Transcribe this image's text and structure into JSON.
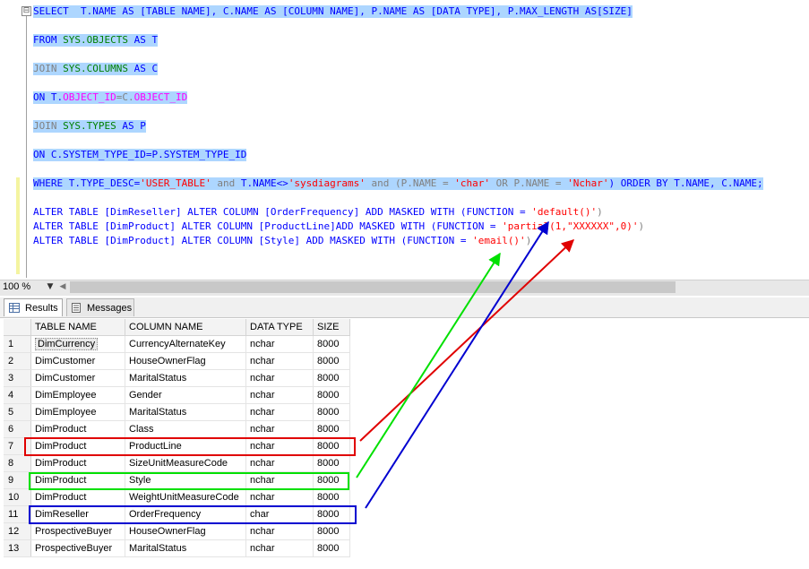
{
  "editor": {
    "lines": [
      [
        "SELECT  T.NAME AS [TABLE NAME], C.NAME AS [COLUMN NAME], P.NAME AS [DATA TYPE], P.MAX_LENGTH AS[SIZE]"
      ],
      [
        "FROM ",
        "SYS.OBJECTS",
        " AS T"
      ],
      [
        "JOIN ",
        "SYS.COLUMNS",
        " AS C"
      ],
      [
        "ON T.",
        "OBJECT_ID",
        "=C.",
        "OBJECT_ID"
      ],
      [
        "JOIN ",
        "SYS.TYPES",
        " AS P"
      ],
      [
        "ON C.SYSTEM_TYPE_ID=P.SYSTEM_TYPE_ID"
      ],
      [
        "WHERE T.TYPE_DESC=",
        "'USER_TABLE'",
        " and ",
        "T.NAME<>",
        "'sysdiagrams'",
        " and (P.NAME = ",
        "'char'",
        " OR P.NAME = ",
        "'Nchar'",
        ") ORDER BY T.NAME, C.NAME;"
      ],
      [
        "ALTER TABLE [DimReseller] ALTER COLUMN [OrderFrequency] ADD MASKED WITH (FUNCTION = ",
        "'default()'",
        ")"
      ],
      [
        "ALTER TABLE [DimProduct] ALTER COLUMN [ProductLine]ADD MASKED WITH (FUNCTION = ",
        "'partial(1,\"XXXXXX\",0)'",
        ")"
      ],
      [
        "ALTER TABLE [DimProduct] ALTER COLUMN [Style] ADD MASKED WITH (FUNCTION = ",
        "'email()'",
        ")"
      ]
    ],
    "collapse_glyph": "⊟"
  },
  "status": {
    "zoom": "100 %",
    "dropdown_glyph": "▼",
    "scroll_left_glyph": "◀"
  },
  "tabs": {
    "results": "Results",
    "messages": "Messages"
  },
  "grid": {
    "columns": [
      "TABLE NAME",
      "COLUMN NAME",
      "DATA TYPE",
      "SIZE"
    ],
    "rows": [
      [
        "1",
        "DimCurrency",
        "CurrencyAlternateKey",
        "nchar",
        "8000"
      ],
      [
        "2",
        "DimCustomer",
        "HouseOwnerFlag",
        "nchar",
        "8000"
      ],
      [
        "3",
        "DimCustomer",
        "MaritalStatus",
        "nchar",
        "8000"
      ],
      [
        "4",
        "DimEmployee",
        "Gender",
        "nchar",
        "8000"
      ],
      [
        "5",
        "DimEmployee",
        "MaritalStatus",
        "nchar",
        "8000"
      ],
      [
        "6",
        "DimProduct",
        "Class",
        "nchar",
        "8000"
      ],
      [
        "7",
        "DimProduct",
        "ProductLine",
        "nchar",
        "8000"
      ],
      [
        "8",
        "DimProduct",
        "SizeUnitMeasureCode",
        "nchar",
        "8000"
      ],
      [
        "9",
        "DimProduct",
        "Style",
        "nchar",
        "8000"
      ],
      [
        "10",
        "DimProduct",
        "WeightUnitMeasureCode",
        "nchar",
        "8000"
      ],
      [
        "11",
        "DimReseller",
        "OrderFrequency",
        "char",
        "8000"
      ],
      [
        "12",
        "ProspectiveBuyer",
        "HouseOwnerFlag",
        "nchar",
        "8000"
      ],
      [
        "13",
        "ProspectiveBuyer",
        "MaritalStatus",
        "nchar",
        "8000"
      ]
    ]
  },
  "annotations": {
    "red": "#e00000",
    "green": "#00e000",
    "blue": "#0000d0"
  }
}
